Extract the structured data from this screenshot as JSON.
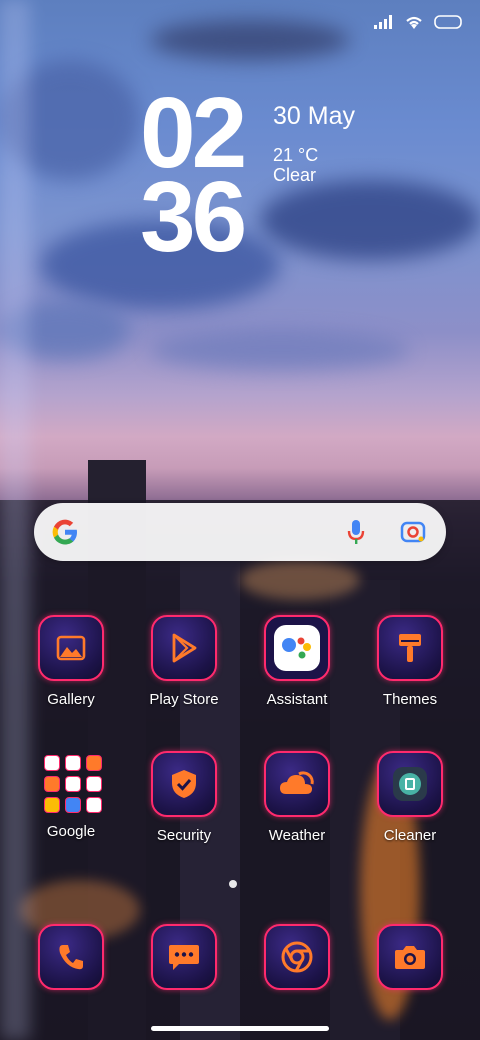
{
  "status": {
    "signal": "signal-icon",
    "wifi": "wifi-icon",
    "battery": "battery-icon"
  },
  "clock": {
    "hours": "02",
    "minutes": "36",
    "date": "30 May",
    "temperature": "21 °C",
    "condition": "Clear"
  },
  "search": {
    "logo": "google-g-icon",
    "mic": "mic-icon",
    "lens": "lens-icon"
  },
  "apps": {
    "gallery": "Gallery",
    "playstore": "Play Store",
    "assistant": "Assistant",
    "themes": "Themes",
    "google": "Google",
    "security": "Security",
    "weather": "Weather",
    "cleaner": "Cleaner"
  },
  "dock": [
    "phone-icon",
    "messages-icon",
    "chrome-icon",
    "camera-icon"
  ],
  "colors": {
    "accent": "#ff2a6d",
    "icon_orange": "#ff7a2a",
    "icon_bg": "#1c1348"
  }
}
